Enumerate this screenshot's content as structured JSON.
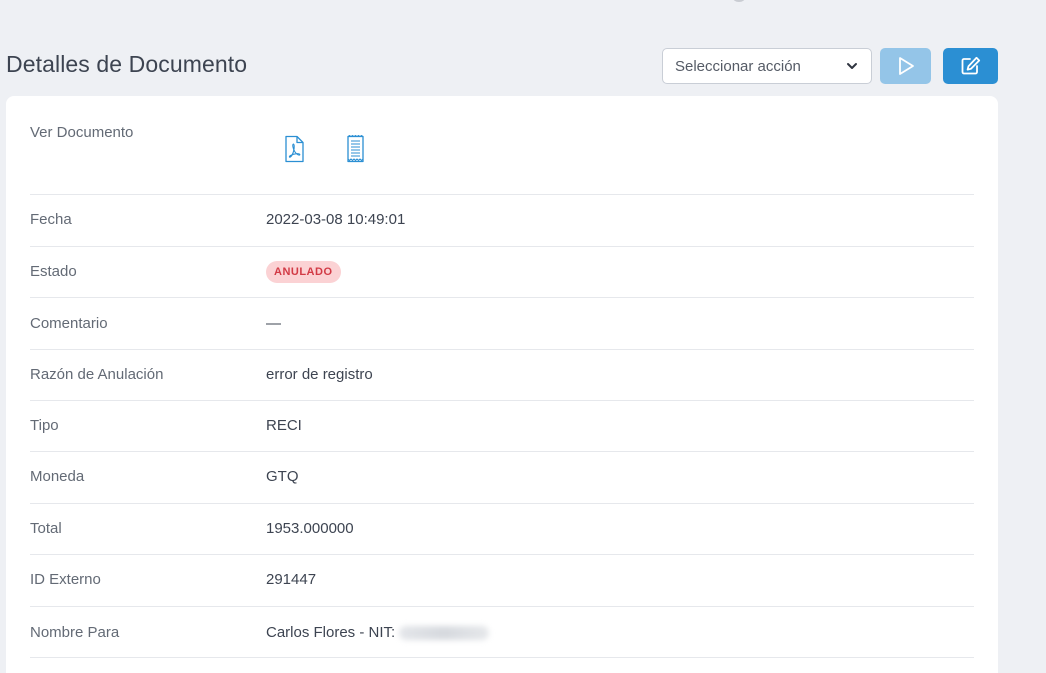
{
  "header": {
    "title": "Detalles de Documento",
    "action_select_placeholder": "Seleccionar acción"
  },
  "details": {
    "ver_documento": {
      "label": "Ver Documento",
      "icons": [
        "pdf-file-icon",
        "xml-document-icon"
      ]
    },
    "fecha": {
      "label": "Fecha",
      "value": "2022-03-08 10:49:01"
    },
    "estado": {
      "label": "Estado",
      "value": "ANULADO"
    },
    "comentario": {
      "label": "Comentario",
      "value": "—"
    },
    "razon": {
      "label": "Razón de Anulación",
      "value": "error de registro"
    },
    "tipo": {
      "label": "Tipo",
      "value": "RECI"
    },
    "moneda": {
      "label": "Moneda",
      "value": "GTQ"
    },
    "total": {
      "label": "Total",
      "value": "1953.000000"
    },
    "id_externo": {
      "label": "ID Externo",
      "value": "291447"
    },
    "nombre_para": {
      "label": "Nombre Para",
      "value": "Carlos Flores - NIT:"
    }
  },
  "colors": {
    "primary": "#2b8fd3",
    "primary_light": "#94c5e8",
    "badge_bg": "#fbd2d4",
    "badge_text": "#d23a45",
    "icon": "#2b8fd3"
  }
}
